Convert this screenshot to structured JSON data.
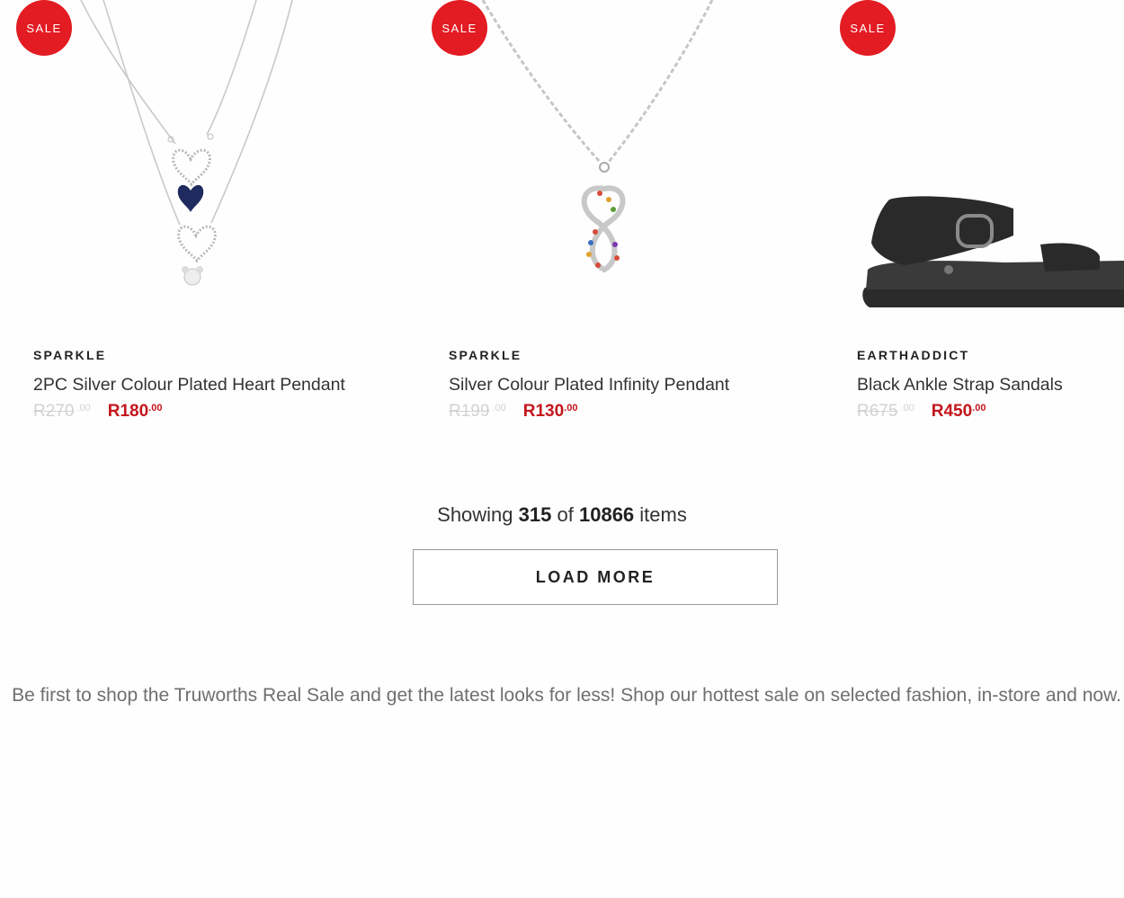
{
  "products": [
    {
      "badge": "SALE",
      "brand": "SPARKLE",
      "title": "2PC Silver Colour Plated Heart Pendant",
      "old_price": "R270",
      "old_cents": ".00",
      "new_price": "R180",
      "new_cents": ".00",
      "image": "double-heart-necklace"
    },
    {
      "badge": "SALE",
      "brand": "SPARKLE",
      "title": "Silver Colour Plated Infinity Pendant",
      "old_price": "R199",
      "old_cents": ".00",
      "new_price": "R130",
      "new_cents": ".00",
      "image": "infinity-pendant-necklace"
    },
    {
      "badge": "SALE",
      "brand": "EARTHADDICT",
      "title": "Black Ankle Strap Sandals",
      "old_price": "R675",
      "old_cents": ".00",
      "new_price": "R450",
      "new_cents": ".00",
      "image": "black-sandal"
    }
  ],
  "pagination": {
    "showing_prefix": "Showing",
    "shown_count": "315",
    "of_word": "of",
    "total_count": "10866",
    "items_word": "items",
    "load_more_label": "LOAD MORE"
  },
  "promo_text": "Be first to shop the Truworths Real Sale and get the latest looks for less! Shop our hottest sale on selected fashion, in-store and now.",
  "colors": {
    "sale_badge": "#e31b23",
    "new_price": "#c4161c",
    "old_price": "#d2d2d2",
    "promo_text": "#6f6f6f"
  }
}
